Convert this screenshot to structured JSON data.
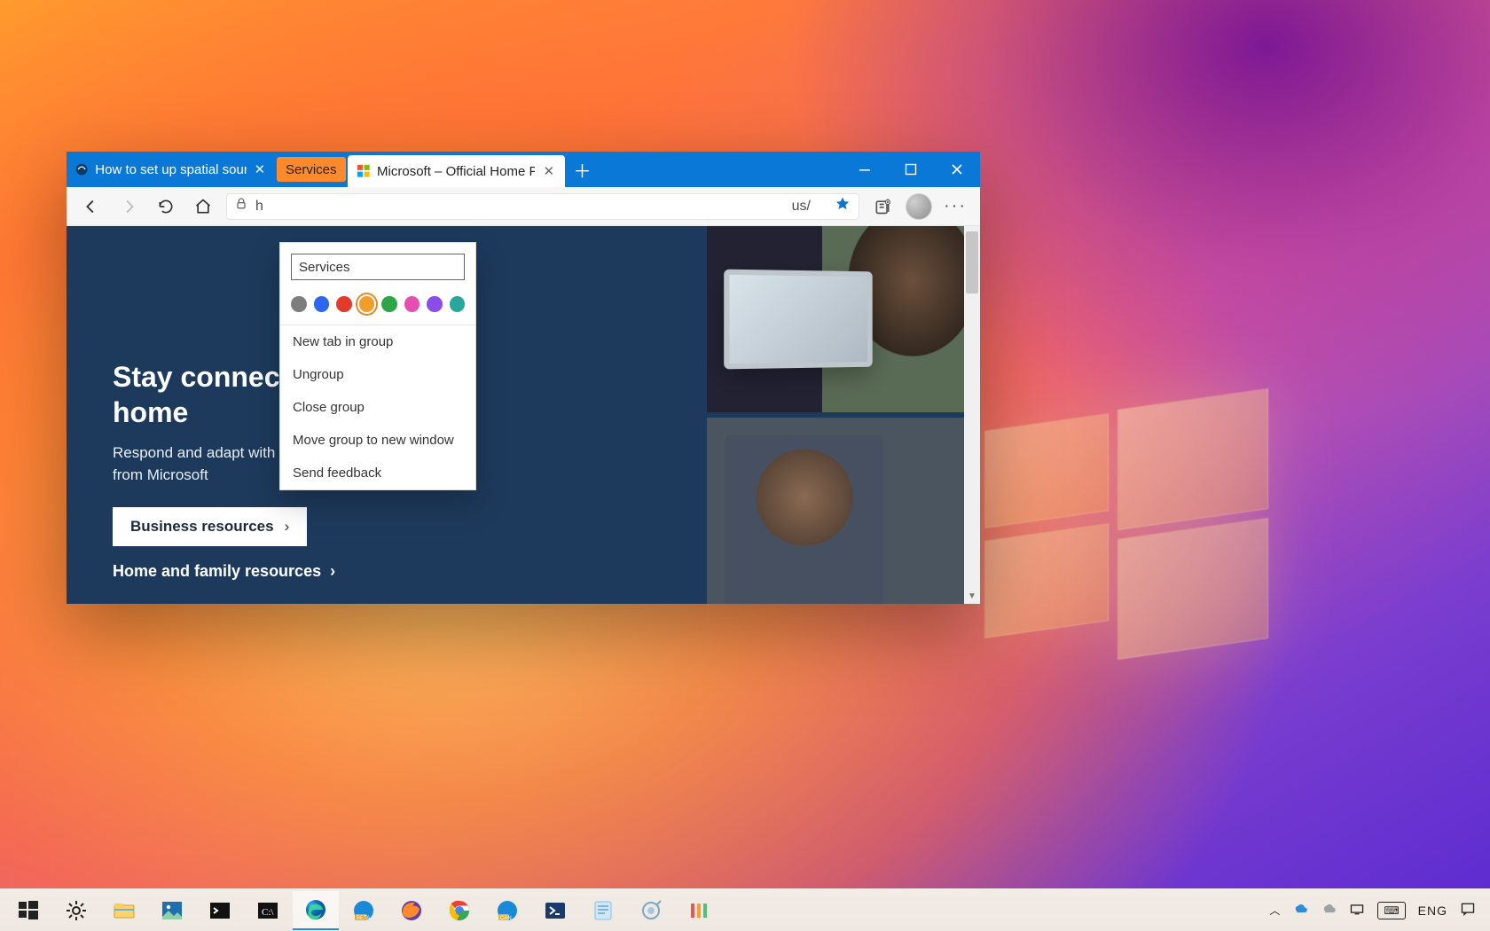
{
  "browser": {
    "tabs": [
      {
        "title": "How to set up spatial sound with",
        "favicon": "pureinfotech"
      },
      {
        "group_chip": "Services",
        "group_color": "#ff8a2c"
      },
      {
        "title": "Microsoft – Official Home Page",
        "favicon": "microsoft",
        "active": true
      }
    ],
    "address": {
      "visible_start": "h",
      "visible_end": "us/"
    },
    "window_buttons": [
      "minimize",
      "maximize",
      "close"
    ]
  },
  "tab_group_popup": {
    "name_value": "Services",
    "swatches": [
      {
        "label": "grey",
        "color": "#7d7d7d"
      },
      {
        "label": "blue",
        "color": "#2d67ef"
      },
      {
        "label": "red",
        "color": "#e23a2d"
      },
      {
        "label": "orange",
        "color": "#f29c2c",
        "selected": true
      },
      {
        "label": "green",
        "color": "#2fa54a"
      },
      {
        "label": "pink",
        "color": "#e54fb3"
      },
      {
        "label": "purple",
        "color": "#8a4de8"
      },
      {
        "label": "teal",
        "color": "#2aa79b"
      }
    ],
    "menu": {
      "new_tab": "New tab in group",
      "ungroup": "Ungroup",
      "close_group": "Close group",
      "move_group": "Move group to new window",
      "send_feedback": "Send feedback"
    }
  },
  "page": {
    "hero_line1": "Stay connected at",
    "hero_line2": "home",
    "hero_p": "Respond and adapt with help resources from Microsoft",
    "cta": "Business resources",
    "link2": "Home and family resources"
  },
  "taskbar": {
    "items": [
      "start",
      "task-view",
      "file-explorer",
      "photos",
      "command-prompt",
      "terminal",
      "edge",
      "edge-beta",
      "firefox",
      "chrome",
      "edge-canary",
      "powershell",
      "notepad",
      "snip",
      "copilot"
    ],
    "tray": {
      "lang": "ENG"
    }
  }
}
